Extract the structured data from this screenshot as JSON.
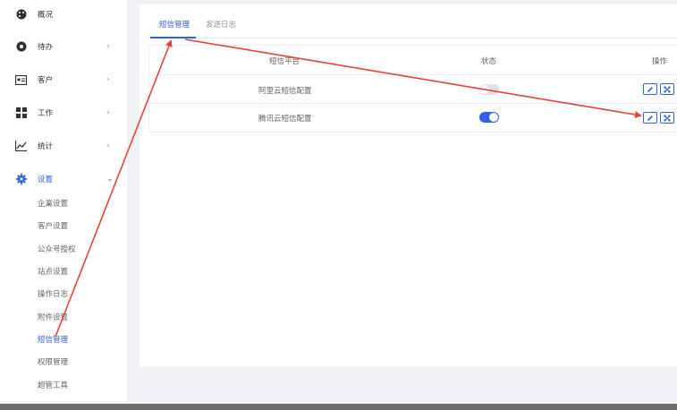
{
  "sidebar": {
    "menu": [
      {
        "label": "概况",
        "icon": "palette-icon",
        "has_chevron": false
      },
      {
        "label": "待办",
        "icon": "compass-icon",
        "has_chevron": true,
        "chevron": "›"
      },
      {
        "label": "客户",
        "icon": "id-card-icon",
        "has_chevron": true,
        "chevron": "›"
      },
      {
        "label": "工作",
        "icon": "grid-icon",
        "has_chevron": true,
        "chevron": "›"
      },
      {
        "label": "统计",
        "icon": "line-chart-icon",
        "has_chevron": true,
        "chevron": "›"
      },
      {
        "label": "设置",
        "icon": "gear-icon",
        "has_chevron": true,
        "chevron": "⌄",
        "active": true
      }
    ],
    "settings_items": [
      {
        "label": "企業设置",
        "active": false
      },
      {
        "label": "客户设置",
        "active": false
      },
      {
        "label": "公众号授权",
        "active": false
      },
      {
        "label": "站点设置",
        "active": false
      },
      {
        "label": "操作日志",
        "active": false
      },
      {
        "label": "附件设置",
        "active": false
      },
      {
        "label": "短信管理",
        "active": true
      },
      {
        "label": "权限管理",
        "active": false
      },
      {
        "label": "超管工具",
        "active": false
      }
    ]
  },
  "main": {
    "tabs": [
      {
        "label": "短信管理",
        "active": true
      },
      {
        "label": "发送日志",
        "active": false
      }
    ],
    "table": {
      "headers": {
        "platform": "短信平台",
        "status": "状态",
        "actions": "操作"
      },
      "rows": [
        {
          "platform": "阿里云短信配置",
          "enabled": false
        },
        {
          "platform": "腾讯云短信配置",
          "enabled": true
        }
      ]
    }
  },
  "colors": {
    "accent": "#2d63e2",
    "annotation_arrow": "#e8403a",
    "toggle_off": "#dcdfe6",
    "page_bg": "#f0f2f5"
  },
  "icons": {
    "edit": "pencil-icon",
    "config": "expand-icon"
  }
}
